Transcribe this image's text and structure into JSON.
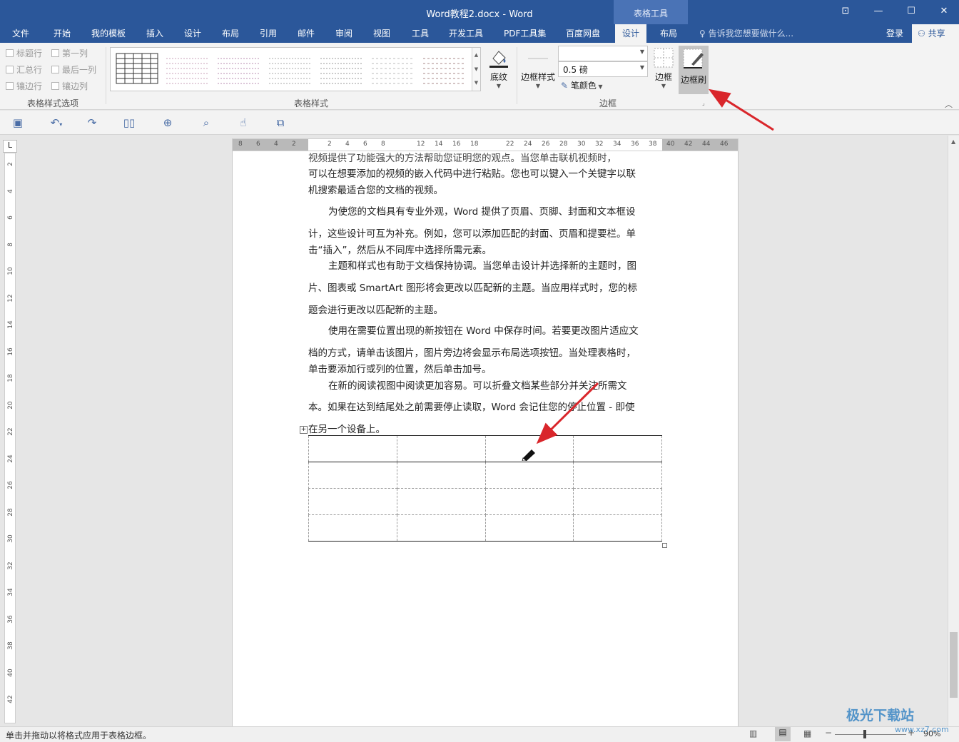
{
  "window": {
    "title": "Word教程2.docx - Word",
    "context_tab": "表格工具",
    "controls": [
      "⊡",
      "—",
      "☐",
      "✕"
    ]
  },
  "tabs": [
    "文件",
    "开始",
    "我的模板",
    "插入",
    "设计",
    "布局",
    "引用",
    "邮件",
    "审阅",
    "视图",
    "工具",
    "开发工具",
    "PDF工具集",
    "百度网盘",
    "设计",
    "布局"
  ],
  "tell_me": "告诉我您想要做什么...",
  "sign_in": "登录",
  "share": "共享",
  "ribbon": {
    "style_options": {
      "items": [
        "标题行",
        "第一列",
        "汇总行",
        "最后一列",
        "镶边行",
        "镶边列"
      ],
      "label": "表格样式选项"
    },
    "table_styles_label": "表格样式",
    "shading_label": "底纹",
    "border_styles_label": "边框样式",
    "pen_weight": "0.5 磅",
    "pen_color_label": "笔颜色",
    "borders_label": "边框",
    "border_painter_label": "边框刷",
    "border_group_label": "边框"
  },
  "ruler": {
    "h_ticks": [
      "8",
      "6",
      "4",
      "2",
      "",
      "2",
      "4",
      "6",
      "8",
      "",
      "12",
      "14",
      "16",
      "18",
      "",
      "22",
      "24",
      "26",
      "28",
      "30",
      "32",
      "34",
      "36",
      "38",
      "40",
      "42",
      "44",
      "46"
    ],
    "v_ticks": [
      "2",
      "4",
      "6",
      "8",
      "10",
      "12",
      "14",
      "16",
      "18",
      "20",
      "22",
      "24",
      "26",
      "28",
      "30",
      "32",
      "34",
      "36",
      "38",
      "40",
      "42"
    ],
    "corner": "L"
  },
  "document": {
    "lines": [
      "视频提供了功能强大的方法帮助您证明您的观点。当您单击联机视频时，",
      "可以在想要添加的视频的嵌入代码中进行粘贴。您也可以键入一个关键字以联",
      "机搜索最适合您的文档的视频。",
      "为使您的文档具有专业外观，Word 提供了页眉、页脚、封面和文本框设",
      "计，这些设计可互为补充。例如，您可以添加匹配的封面、页眉和提要栏。单",
      "击“插入”，然后从不同库中选择所需元素。",
      "主题和样式也有助于文档保持协调。当您单击设计并选择新的主题时，图",
      "片、图表或 SmartArt 图形将会更改以匹配新的主题。当应用样式时，您的标",
      "题会进行更改以匹配新的主题。",
      "使用在需要位置出现的新按钮在 Word 中保存时间。若要更改图片适应文",
      "档的方式，请单击该图片，图片旁边将会显示布局选项按钮。当处理表格时，",
      "单击要添加行或列的位置，然后单击加号。",
      "在新的阅读视图中阅读更加容易。可以折叠文档某些部分并关注所需文",
      "本。如果在达到结尾处之前需要停止读取，Word 会记住您的停止位置 - 即使",
      "在另一个设备上。"
    ],
    "table": {
      "rows": 4,
      "cols": 4
    }
  },
  "status": {
    "message": "单击并拖动以将格式应用于表格边框。",
    "zoom": "90%"
  },
  "watermark": {
    "text": "极光下载站",
    "url": "www.xz7.com"
  },
  "colors": {
    "title_bar": "#2b579a",
    "annotation_arrow": "#d9262b"
  }
}
